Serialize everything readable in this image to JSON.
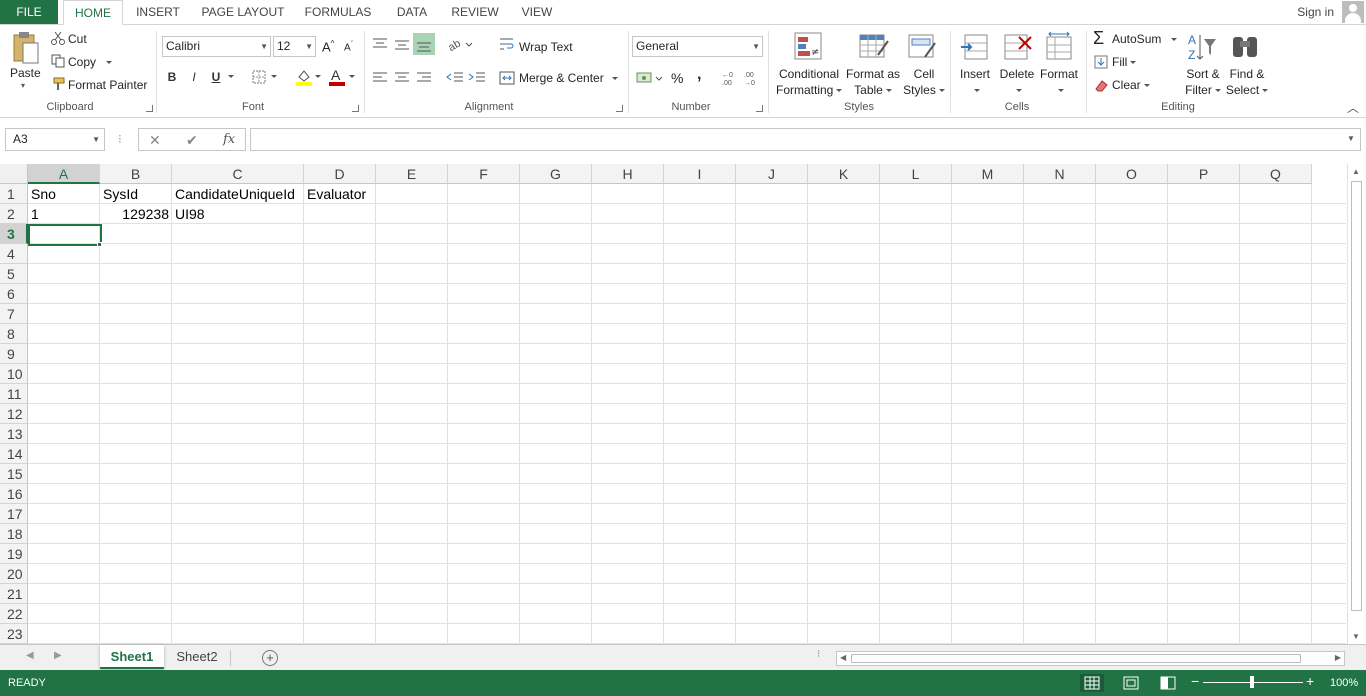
{
  "tabs": {
    "file": "FILE",
    "items": [
      "HOME",
      "INSERT",
      "PAGE LAYOUT",
      "FORMULAS",
      "DATA",
      "REVIEW",
      "VIEW"
    ],
    "active": "HOME",
    "signin": "Sign in"
  },
  "ribbon": {
    "clipboard": {
      "paste": "Paste",
      "cut": "Cut",
      "copy": "Copy",
      "format_painter": "Format Painter",
      "label": "Clipboard"
    },
    "font": {
      "name": "Calibri",
      "size": "12",
      "bold": "B",
      "italic": "I",
      "underline": "U",
      "grow": "A",
      "shrink": "A",
      "label": "Font"
    },
    "alignment": {
      "wrap_text": "Wrap Text",
      "merge_center": "Merge & Center",
      "label": "Alignment"
    },
    "number": {
      "format": "General",
      "percent": "%",
      "comma": ",",
      "label": "Number"
    },
    "styles": {
      "conditional": [
        "Conditional",
        "Formatting"
      ],
      "format_table": [
        "Format as",
        "Table"
      ],
      "cell_styles": [
        "Cell",
        "Styles"
      ],
      "label": "Styles"
    },
    "cells": {
      "insert": "Insert",
      "delete": "Delete",
      "format": "Format",
      "label": "Cells"
    },
    "editing": {
      "autosum": "AutoSum",
      "fill": "Fill",
      "clear": "Clear",
      "sort_filter": [
        "Sort &",
        "Filter"
      ],
      "find_select": [
        "Find &",
        "Select"
      ],
      "label": "Editing"
    }
  },
  "formula_bar": {
    "name_box": "A3",
    "fx": "fx",
    "cancel": "✕",
    "enter": "✔",
    "value": ""
  },
  "grid": {
    "columns": [
      "A",
      "B",
      "C",
      "D",
      "E",
      "F",
      "G",
      "H",
      "I",
      "J",
      "K",
      "L",
      "M",
      "N",
      "O",
      "P",
      "Q"
    ],
    "rows": [
      "1",
      "2",
      "3",
      "4",
      "5",
      "6",
      "7",
      "8",
      "9",
      "10",
      "11",
      "12",
      "13",
      "14",
      "15",
      "16",
      "17",
      "18",
      "19",
      "20",
      "21",
      "22",
      "23"
    ],
    "selected_column": "A",
    "selected_row": "3",
    "data": {
      "A1": "Sno",
      "B1": "SysId",
      "C1": "CandidateUniqueId",
      "D1": "Evaluator",
      "A2": "1",
      "B2": "129238",
      "C2": "UI98"
    }
  },
  "sheets": {
    "tabs": [
      "Sheet1",
      "Sheet2"
    ],
    "active": "Sheet1",
    "add": "+"
  },
  "status": {
    "text": "READY",
    "zoom": "100%",
    "minus": "−",
    "plus": "+"
  },
  "colors": {
    "accent": "#217346"
  }
}
